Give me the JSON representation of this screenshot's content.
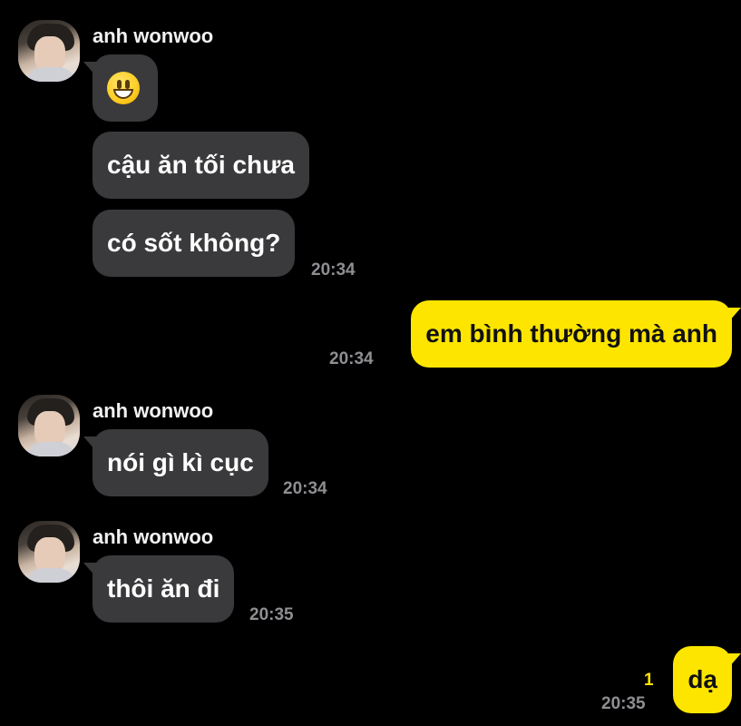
{
  "conversation": {
    "sender_name": "anh wonwoo",
    "messages": [
      {
        "id": "m1",
        "from": "them",
        "emoji": "grinning-face"
      },
      {
        "id": "m2",
        "from": "them",
        "text": "cậu ăn tối chưa"
      },
      {
        "id": "m3",
        "from": "them",
        "text": "có sốt không?",
        "time": "20:34"
      },
      {
        "id": "m4",
        "from": "me",
        "text": "em bình thường mà anh",
        "time": "20:34"
      },
      {
        "id": "m5",
        "from": "them",
        "text": "nói gì kì cục",
        "time": "20:34"
      },
      {
        "id": "m6",
        "from": "them",
        "text": "thôi ăn đi",
        "time": "20:35"
      },
      {
        "id": "m7",
        "from": "me",
        "text": "dạ",
        "time": "20:35",
        "unread_count": "1"
      }
    ]
  },
  "colors": {
    "background": "#000000",
    "incoming_bubble": "#3a3a3c",
    "outgoing_bubble": "#fee500",
    "timestamp": "#8e8e93"
  }
}
